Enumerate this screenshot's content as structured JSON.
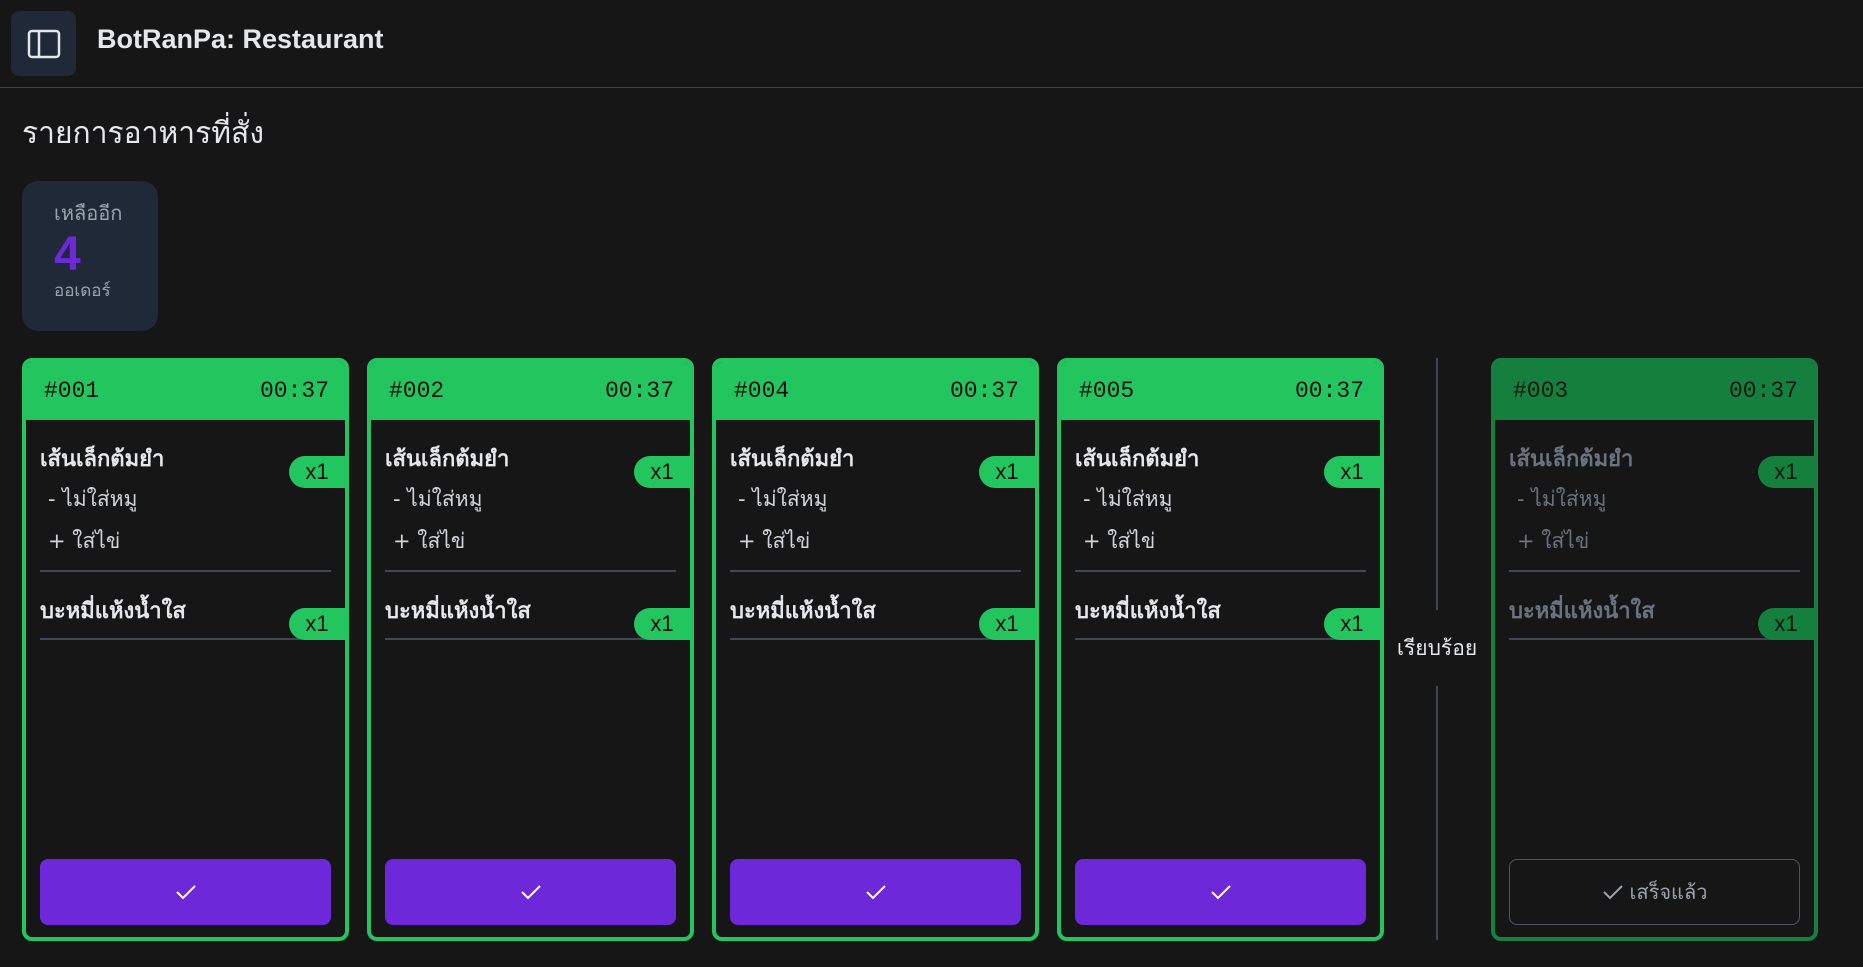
{
  "app": {
    "title": "BotRanPa: Restaurant",
    "page_title": "รายการอาหารที่สั่ง"
  },
  "remaining": {
    "label": "เหลืออีก",
    "count": "4",
    "unit": "ออเดอร์"
  },
  "colors": {
    "pending_accent": "#22c55e",
    "done_accent": "#15803d",
    "button": "#6d28d9"
  },
  "separator_label": "เรียบร้อย",
  "done_button_label": "เสร็จแล้ว",
  "orders": [
    {
      "id": "#001",
      "time": "00:37",
      "status": "pending",
      "items": [
        {
          "name": "เส้นเล็กต้มยำ",
          "qty": "x1",
          "mods": [
            "- ไม่ใส่หมู",
            "+ ใส่ไข่"
          ]
        },
        {
          "name": "บะหมี่แห้งน้ำใส",
          "qty": "x1",
          "mods": []
        }
      ]
    },
    {
      "id": "#002",
      "time": "00:37",
      "status": "pending",
      "items": [
        {
          "name": "เส้นเล็กต้มยำ",
          "qty": "x1",
          "mods": [
            "- ไม่ใส่หมู",
            "+ ใส่ไข่"
          ]
        },
        {
          "name": "บะหมี่แห้งน้ำใส",
          "qty": "x1",
          "mods": []
        }
      ]
    },
    {
      "id": "#004",
      "time": "00:37",
      "status": "pending",
      "items": [
        {
          "name": "เส้นเล็กต้มยำ",
          "qty": "x1",
          "mods": [
            "- ไม่ใส่หมู",
            "+ ใส่ไข่"
          ]
        },
        {
          "name": "บะหมี่แห้งน้ำใส",
          "qty": "x1",
          "mods": []
        }
      ]
    },
    {
      "id": "#005",
      "time": "00:37",
      "status": "pending",
      "items": [
        {
          "name": "เส้นเล็กต้มยำ",
          "qty": "x1",
          "mods": [
            "- ไม่ใส่หมู",
            "+ ใส่ไข่"
          ]
        },
        {
          "name": "บะหมี่แห้งน้ำใส",
          "qty": "x1",
          "mods": []
        }
      ]
    },
    {
      "id": "#003",
      "time": "00:37",
      "status": "done",
      "items": [
        {
          "name": "เส้นเล็กต้มยำ",
          "qty": "x1",
          "mods": [
            "- ไม่ใส่หมู",
            "+ ใส่ไข่"
          ]
        },
        {
          "name": "บะหมี่แห้งน้ำใส",
          "qty": "x1",
          "mods": []
        }
      ]
    }
  ]
}
